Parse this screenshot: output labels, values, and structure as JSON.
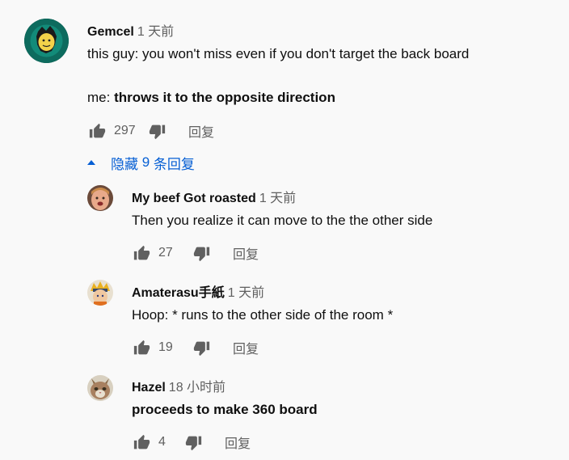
{
  "comment": {
    "author": "Gemcel",
    "time": "1 天前",
    "line1": "this guy: you won't miss even if you don't target the back board",
    "line2_prefix": "me: ",
    "line2_bold": "throws it to the opposite direction",
    "likes": "297",
    "reply_label": "回复",
    "icons": {
      "like": "thumbs-up-icon",
      "dislike": "thumbs-down-icon"
    }
  },
  "hide_replies": {
    "label_prefix": "隐藏 ",
    "count": "9",
    "label_suffix": " 条回复",
    "color": "#065fd4"
  },
  "replies": [
    {
      "author": "My beef Got roasted",
      "time": "1 天前",
      "text": "Then you realize it can move to the the other side",
      "bold": false,
      "likes": "27",
      "reply_label": "回复"
    },
    {
      "author": "Amaterasu手紙",
      "time": "1 天前",
      "text": "Hoop: * runs to the other side of the room *",
      "bold": false,
      "likes": "19",
      "reply_label": "回复"
    },
    {
      "author": "Hazel",
      "time": "18 小时前",
      "text": "proceeds to make 360 board",
      "bold": true,
      "likes": "4",
      "reply_label": "回复"
    }
  ],
  "colors": {
    "background": "#f9f9f9",
    "text": "#0f0f0f",
    "secondary": "#606060",
    "icon": "#606060",
    "link": "#065fd4"
  }
}
